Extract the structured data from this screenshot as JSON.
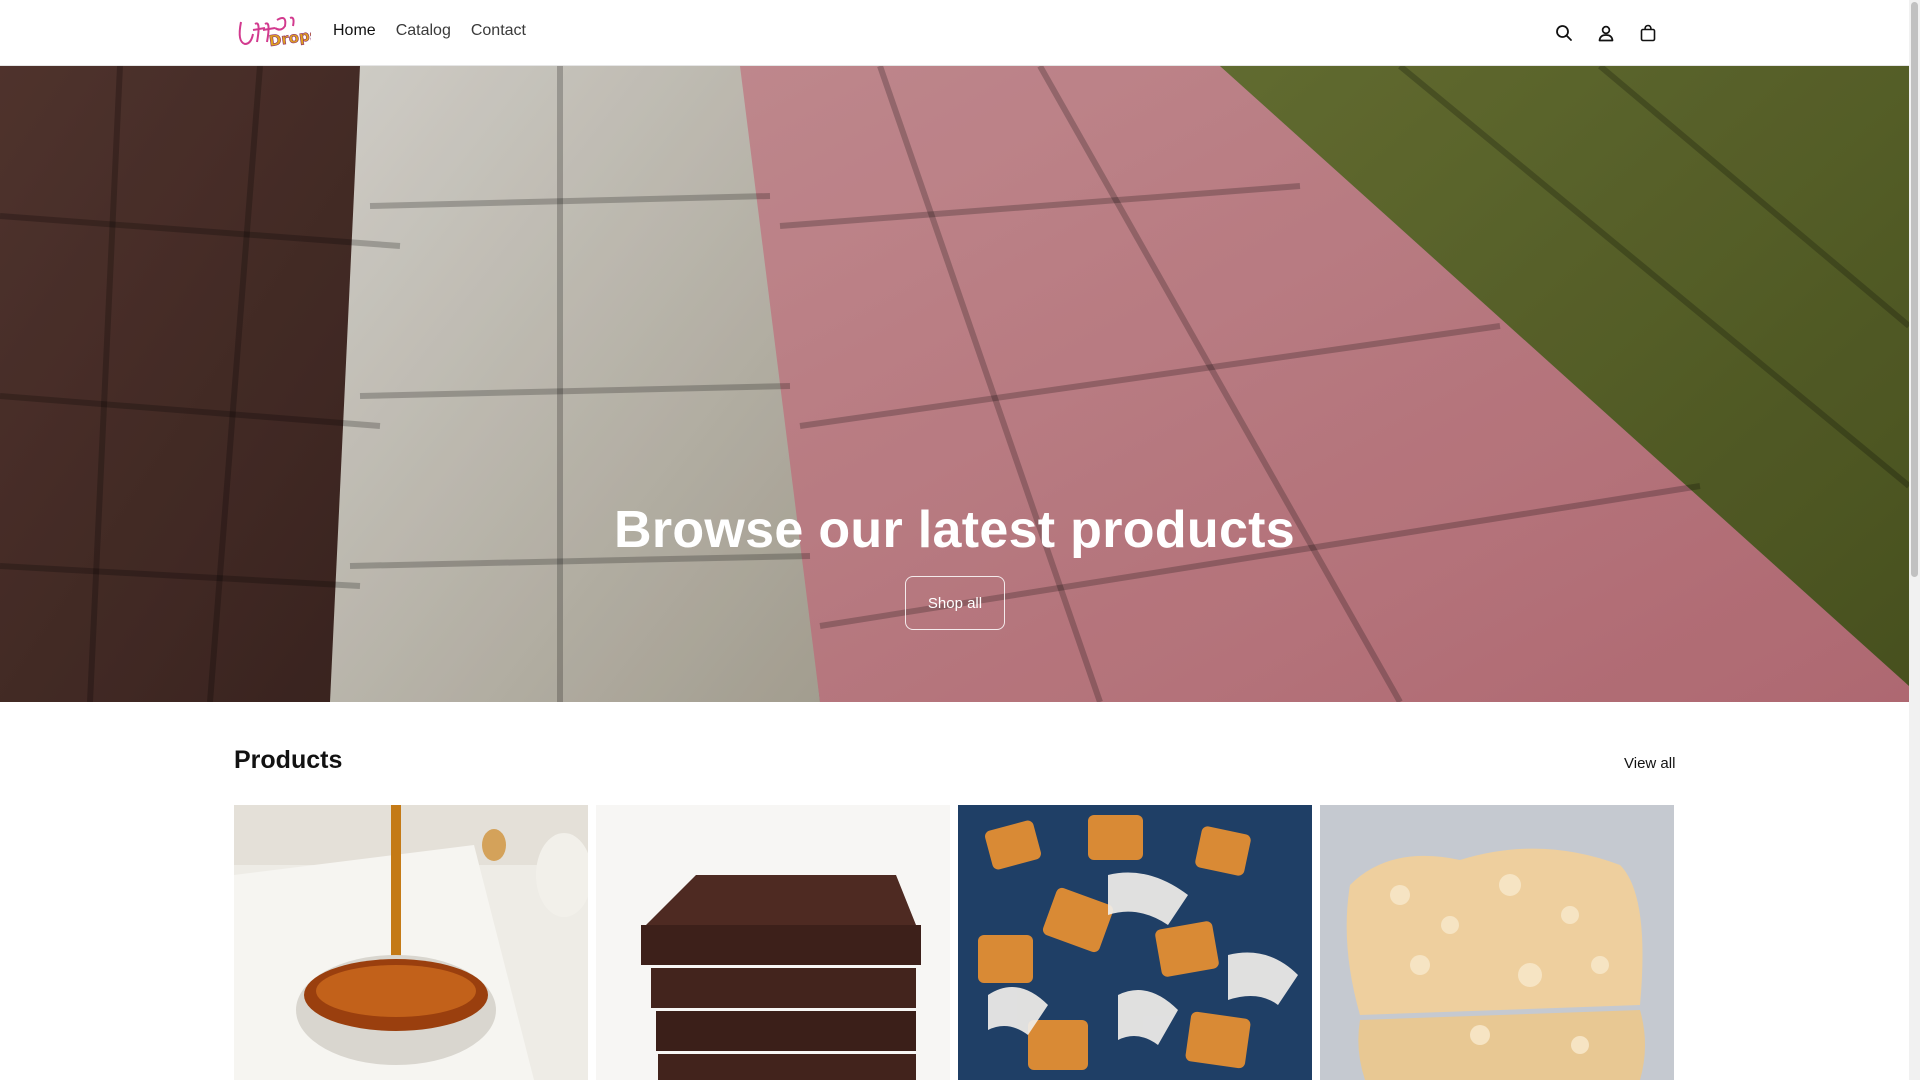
{
  "brand": {
    "logo_text": "Jiffery Drops!"
  },
  "nav": {
    "items": [
      {
        "label": "Home"
      },
      {
        "label": "Catalog"
      },
      {
        "label": "Contact"
      }
    ]
  },
  "header_icons": [
    "search-icon",
    "account-icon",
    "cart-icon"
  ],
  "hero": {
    "title": "Browse our latest products",
    "button_label": "Shop all"
  },
  "products": {
    "title": "Products",
    "view_all_label": "View all",
    "items": [
      {
        "image": "syrup-bowl-image"
      },
      {
        "image": "brownie-stack-image"
      },
      {
        "image": "caramels-image"
      },
      {
        "image": "crispy-bar-image"
      }
    ]
  },
  "colors": {
    "text": "#121212",
    "hero_text": "#ffffff",
    "background": "#ffffff"
  }
}
